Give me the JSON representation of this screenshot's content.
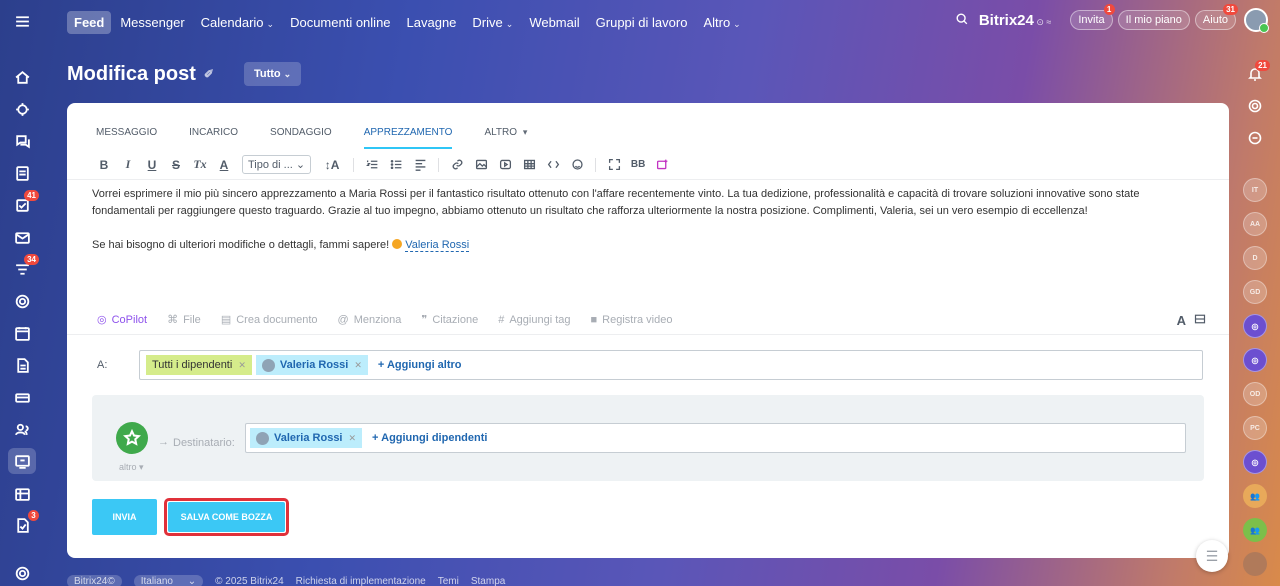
{
  "topnav": {
    "items": [
      {
        "label": "Feed",
        "active": true
      },
      {
        "label": "Messenger"
      },
      {
        "label": "Calendario",
        "caret": "⌄"
      },
      {
        "label": "Documenti online"
      },
      {
        "label": "Lavagne"
      },
      {
        "label": "Drive",
        "caret": "⌄"
      },
      {
        "label": "Webmail"
      },
      {
        "label": "Gruppi di lavoro"
      },
      {
        "label": "Altro",
        "caret": "⌄"
      }
    ],
    "brand": "Bitrix24",
    "invite_label": "Invita",
    "invite_count": "1",
    "plan_label": "Il mio piano",
    "help_label": "Aiuto",
    "help_count": "31"
  },
  "left_rail_counters": {
    "tasks": "41",
    "feed": "34",
    "workflows": "3"
  },
  "right_rail": {
    "notify_count": "21",
    "avatars": [
      "IT",
      "AA",
      "D",
      "GD",
      "OD",
      "PC"
    ]
  },
  "page": {
    "title": "Modifica post",
    "filter_label": "Tutto"
  },
  "tabs": [
    "MESSAGGIO",
    "INCARICO",
    "SONDAGGIO",
    "APPREZZAMENTO",
    "ALTRO"
  ],
  "toolbar": {
    "bold": "B",
    "italic": "I",
    "underline": "U",
    "strike": "S",
    "clear": "Tx",
    "color": "A",
    "style_select": "Tipo di ...",
    "size": "↕A",
    "bbcode": "BB"
  },
  "editor": {
    "para1": "Vorrei esprimere il mio più sincero apprezzamento a Maria Rossi per il fantastico risultato ottenuto con l'affare recentemente vinto. La tua dedizione, professionalità e capacità di trovare soluzioni innovative sono state fondamentali per raggiungere questo traguardo. Grazie al tuo impegno, abbiamo ottenuto un risultato che rafforza ulteriormente la nostra posizione. Complimenti, Valeria, sei un vero esempio di eccellenza!",
    "para2_text": "Se hai bisogno di ulteriori modifiche o dettagli, fammi sapere!",
    "mention": "Valeria Rossi"
  },
  "actions": {
    "copilot": "CoPilot",
    "file": "File",
    "create_doc": "Crea documento",
    "mention": "Menziona",
    "quote": "Citazione",
    "tag": "Aggiungi tag",
    "video": "Registra video",
    "font": "A"
  },
  "recipients": {
    "label": "A:",
    "chips": [
      "Tutti i dipendenti",
      "Valeria Rossi"
    ],
    "add_label": "+ Aggiungi altro"
  },
  "gratitude": {
    "label": "Destinatario:",
    "more": "altro",
    "chip": "Valeria Rossi",
    "add_label": "+ Aggiungi dipendenti"
  },
  "buttons": {
    "send": "INVIA",
    "draft": "SALVA COME BOZZA"
  },
  "footer": {
    "brand": "Bitrix24©",
    "lang": "Italiano",
    "copyright": "© 2025 Bitrix24",
    "request": "Richiesta di implementazione",
    "themes": "Temi",
    "print": "Stampa"
  }
}
